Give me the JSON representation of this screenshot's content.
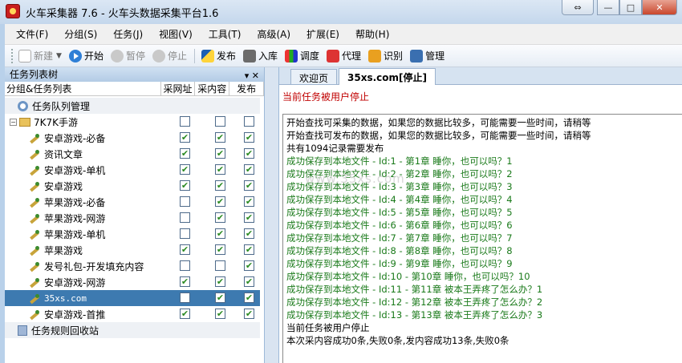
{
  "window": {
    "title": "火车采集器 7.6 - 火车头数据采集平台1.6",
    "buttons": [
      "⇔",
      "—",
      "□",
      "✕"
    ]
  },
  "menu": [
    "文件(F)",
    "分组(S)",
    "任务(J)",
    "视图(V)",
    "工具(T)",
    "高级(A)",
    "扩展(E)",
    "帮助(H)"
  ],
  "toolbar": {
    "new": "新建",
    "start": "开始",
    "pause": "暂停",
    "stop": "停止",
    "publish": "发布",
    "import": "入库",
    "adjust": "调度",
    "proxy": "代理",
    "identify": "识别",
    "manage": "管理"
  },
  "left_panel": {
    "title": "任务列表树",
    "pin": "▾ ✕",
    "columns": {
      "name": "分组&任务列表",
      "c1": "采网址",
      "c2": "采内容",
      "c3": "发布"
    },
    "rows": [
      {
        "label": "任务队列管理",
        "kind": "queue",
        "checks": null
      },
      {
        "label": "7K7K手游",
        "kind": "group",
        "checks": [
          false,
          false,
          false
        ]
      },
      {
        "label": "安卓游戏-必备",
        "kind": "task",
        "checks": [
          true,
          true,
          true
        ]
      },
      {
        "label": "资讯文章",
        "kind": "task",
        "checks": [
          true,
          true,
          true
        ]
      },
      {
        "label": "安卓游戏-单机",
        "kind": "task",
        "checks": [
          true,
          true,
          true
        ]
      },
      {
        "label": "安卓游戏",
        "kind": "task",
        "checks": [
          true,
          true,
          true
        ]
      },
      {
        "label": "苹果游戏-必备",
        "kind": "task",
        "checks": [
          false,
          true,
          true
        ]
      },
      {
        "label": "苹果游戏-网游",
        "kind": "task",
        "checks": [
          false,
          true,
          true
        ]
      },
      {
        "label": "苹果游戏-单机",
        "kind": "task",
        "checks": [
          false,
          true,
          true
        ]
      },
      {
        "label": "苹果游戏",
        "kind": "task",
        "checks": [
          true,
          true,
          true
        ]
      },
      {
        "label": "发号礼包-开发填充内容",
        "kind": "task",
        "checks": [
          false,
          false,
          true
        ]
      },
      {
        "label": "安卓游戏-网游",
        "kind": "task",
        "checks": [
          true,
          true,
          true
        ]
      },
      {
        "label": "35xs.com",
        "kind": "task",
        "checks": [
          false,
          true,
          true
        ],
        "selected": true
      },
      {
        "label": "安卓游戏-首推",
        "kind": "task",
        "checks": [
          true,
          true,
          true
        ]
      },
      {
        "label": "任务规则回收站",
        "kind": "bin",
        "checks": null
      }
    ]
  },
  "right_panel": {
    "tabs": [
      "欢迎页",
      "35xs.com[停止]"
    ],
    "status": "当前任务被用户停止",
    "watermark": "www.35xs.com",
    "log": [
      {
        "text": "开始查找可采集的数据，如果您的数据比较多，可能需要一些时间，请稍等",
        "ok": false
      },
      {
        "text": "开始查找可发布的数据，如果您的数据比较多，可能需要一些时间，请稍等",
        "ok": false
      },
      {
        "text": "共有1094记录需要发布",
        "ok": false
      },
      {
        "text": "成功保存到本地文件 - Id:1 - 第1章 睡你，也可以吗？1",
        "ok": true
      },
      {
        "text": "成功保存到本地文件 - Id:2 - 第2章 睡你，也可以吗？2",
        "ok": true
      },
      {
        "text": "成功保存到本地文件 - Id:3 - 第3章 睡你，也可以吗？3",
        "ok": true
      },
      {
        "text": "成功保存到本地文件 - Id:4 - 第4章 睡你，也可以吗？4",
        "ok": true
      },
      {
        "text": "成功保存到本地文件 - Id:5 - 第5章 睡你，也可以吗？5",
        "ok": true
      },
      {
        "text": "成功保存到本地文件 - Id:6 - 第6章 睡你，也可以吗？6",
        "ok": true
      },
      {
        "text": "成功保存到本地文件 - Id:7 - 第7章 睡你，也可以吗？7",
        "ok": true
      },
      {
        "text": "成功保存到本地文件 - Id:8 - 第8章 睡你，也可以吗？8",
        "ok": true
      },
      {
        "text": "成功保存到本地文件 - Id:9 - 第9章 睡你，也可以吗？9",
        "ok": true
      },
      {
        "text": "成功保存到本地文件 - Id:10 - 第10章 睡你，也可以吗？10",
        "ok": true
      },
      {
        "text": "成功保存到本地文件 - Id:11 - 第11章 被本王弄疼了怎么办？1",
        "ok": true
      },
      {
        "text": "成功保存到本地文件 - Id:12 - 第12章 被本王弄疼了怎么办？2",
        "ok": true
      },
      {
        "text": "成功保存到本地文件 - Id:13 - 第13章 被本王弄疼了怎么办？3",
        "ok": true
      },
      {
        "text": "当前任务被用户停止",
        "ok": false
      },
      {
        "text": "本次采内容成功0条,失败0条,发内容成功13条,失败0条",
        "ok": false
      }
    ]
  }
}
